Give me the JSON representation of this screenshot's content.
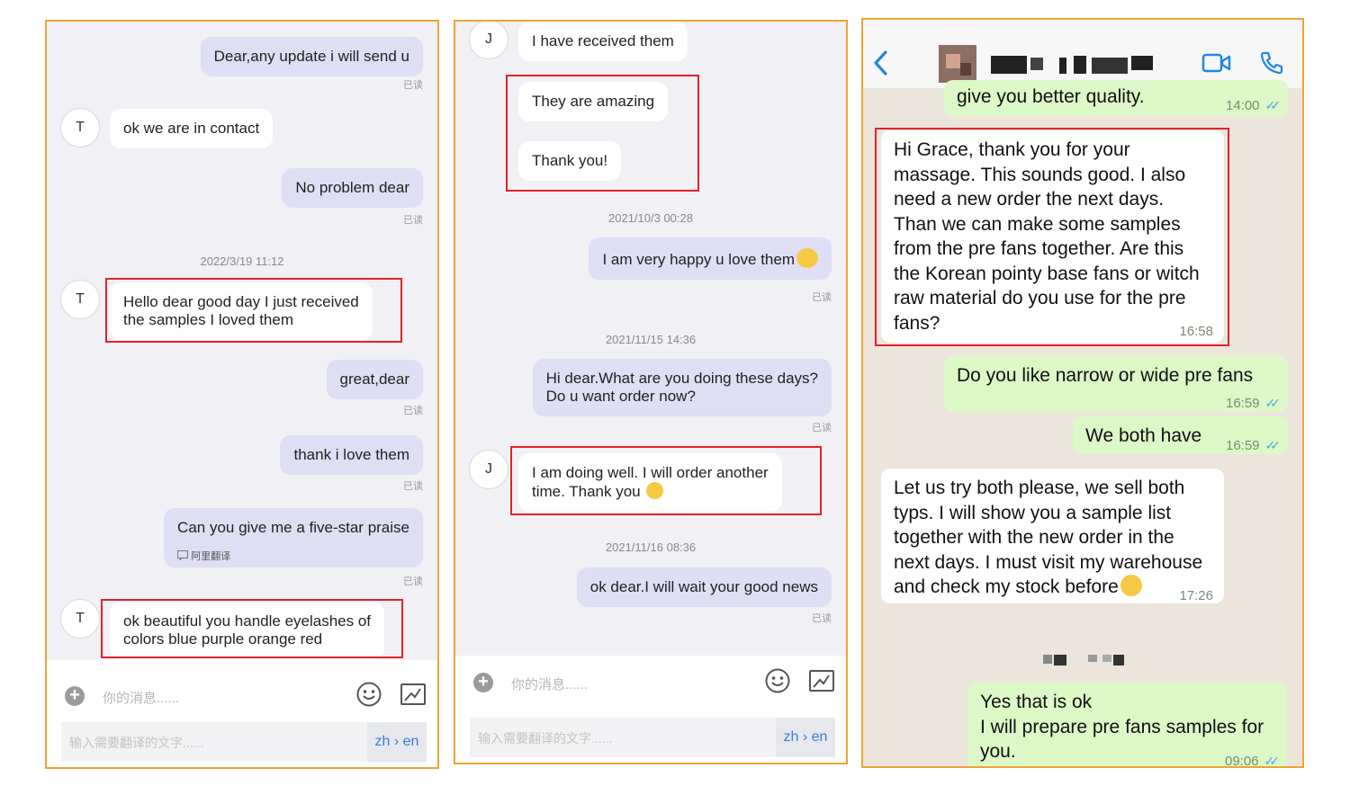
{
  "panel1": {
    "messages": [
      {
        "text": "Dear,any update i will send u",
        "read": "已读"
      },
      {
        "text": "ok we are in contact",
        "avatar": "T"
      },
      {
        "text": "No problem dear",
        "read": "已读"
      },
      {
        "timestamp": "2022/3/19 11:12"
      },
      {
        "line1": "Hello dear good day I just received",
        "line2": "the samples I loved them",
        "avatar": "T"
      },
      {
        "text": "great,dear",
        "read": "已读"
      },
      {
        "text": "thank i love them",
        "read": "已读"
      },
      {
        "text": "Can you give me a five-star praise",
        "tag": "阿里翻译",
        "read": "已读"
      },
      {
        "line1": "ok beautiful you handle eyelashes of",
        "line2": "colors blue purple orange red",
        "avatar": "T"
      }
    ],
    "composer": {
      "placeholder": "你的消息......",
      "translate_placeholder": "输入需要翻译的文字......",
      "lang": "zh › en"
    }
  },
  "panel2": {
    "messages": [
      {
        "text": "I have received them",
        "avatar": "J"
      },
      {
        "text": "They are amazing"
      },
      {
        "text": "Thank you!"
      },
      {
        "timestamp": "2021/10/3 00:28"
      },
      {
        "text": "I am very happy u love them",
        "read": "已读"
      },
      {
        "timestamp": "2021/11/15 14:36"
      },
      {
        "line1": "Hi dear.What are you doing these days?",
        "line2": "Do u want order now?",
        "read": "已读"
      },
      {
        "line1": "I am doing well. I will order another",
        "line2": "time. Thank you",
        "avatar": "J"
      },
      {
        "timestamp": "2021/11/16 08:36"
      },
      {
        "text": "ok dear.I will wait your good news",
        "read": "已读"
      }
    ],
    "composer": {
      "placeholder": "你的消息......",
      "translate_placeholder": "输入需要翻译的文字......",
      "lang": "zh › en"
    }
  },
  "panel3": {
    "messages": [
      {
        "text": "give you better quality.",
        "time": "14:00"
      },
      {
        "lines": [
          "Hi Grace, thank you for your",
          "massage. This sounds good. I also",
          "need a new order the next days.",
          "Than we can make some samples",
          "from the pre fans together. Are this",
          "the Korean pointy base fans or witch",
          "raw material do you use for the pre",
          "fans?"
        ],
        "time": "16:58"
      },
      {
        "text": "Do you like narrow or wide pre fans",
        "time": "16:59"
      },
      {
        "text": "We both have",
        "time": "16:59"
      },
      {
        "lines": [
          "Let us try both please, we sell both",
          "typs. I will show you a sample list",
          "together with the new order in the",
          "next days. I must visit my warehouse",
          "and check my stock before"
        ],
        "time": "17:26"
      },
      {
        "lines": [
          "Yes that is ok",
          "I will prepare pre fans samples for",
          "you."
        ],
        "time": "09:06"
      }
    ]
  },
  "colors": {
    "highlight": "#e0222a",
    "panel_border": "#f0a434",
    "outgoing": "#dedff5",
    "wa_outgoing": "#dcf8c6",
    "link": "#3b7bd4"
  }
}
